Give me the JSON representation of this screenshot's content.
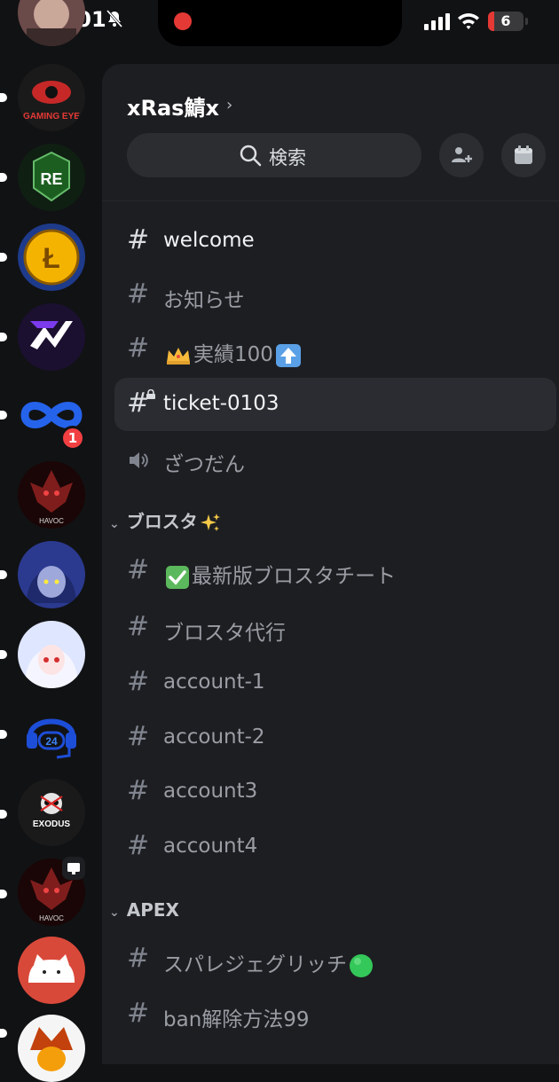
{
  "status_bar": {
    "time": "3:01",
    "battery_level": "6"
  },
  "server_rail": {
    "servers": [
      {
        "name": "GAMING EYE"
      },
      {
        "name": "RE"
      },
      {
        "name": "Litecoin"
      },
      {
        "name": "N"
      },
      {
        "name": "infinity",
        "mentions": "1"
      },
      {
        "name": "HAVOC"
      },
      {
        "name": "anime-blue"
      },
      {
        "name": "anime-white"
      },
      {
        "name": "24 support"
      },
      {
        "name": "EXODUS"
      },
      {
        "name": "HAVOC live"
      },
      {
        "name": "bongo cat"
      },
      {
        "name": "warrior"
      }
    ]
  },
  "server_header": {
    "name": "xRas鯖x",
    "search_label": "検索"
  },
  "channels": {
    "top": [
      {
        "name": "welcome",
        "type": "text",
        "unread": true
      },
      {
        "name": "お知らせ",
        "type": "text"
      },
      {
        "name": "実績100",
        "type": "text",
        "prefix_emoji": "crown-emoji",
        "suffix_emoji": "up-arrow-emoji"
      },
      {
        "name": "ticket-0103",
        "type": "text-locked",
        "active": true
      },
      {
        "name": "ざつだん",
        "type": "voice"
      }
    ],
    "category_brawl": {
      "name": "ブロスタ",
      "emoji": "sparkles-emoji",
      "items": [
        {
          "name": "最新版ブロスタチート",
          "prefix_emoji": "check-emoji"
        },
        {
          "name": "ブロスタ代行"
        },
        {
          "name": "account-1"
        },
        {
          "name": "account-2"
        },
        {
          "name": "account3"
        },
        {
          "name": "account4"
        }
      ]
    },
    "category_apex": {
      "name": "APEX",
      "items": [
        {
          "name": "スパレジェグリッチ",
          "suffix_emoji": "green-circle-emoji"
        },
        {
          "name": "ban解除方法99"
        }
      ]
    }
  },
  "colors": {
    "background": "#111214",
    "panel": "#1d1e22",
    "active_row": "#2a2c31",
    "badge": "#f23f42"
  }
}
